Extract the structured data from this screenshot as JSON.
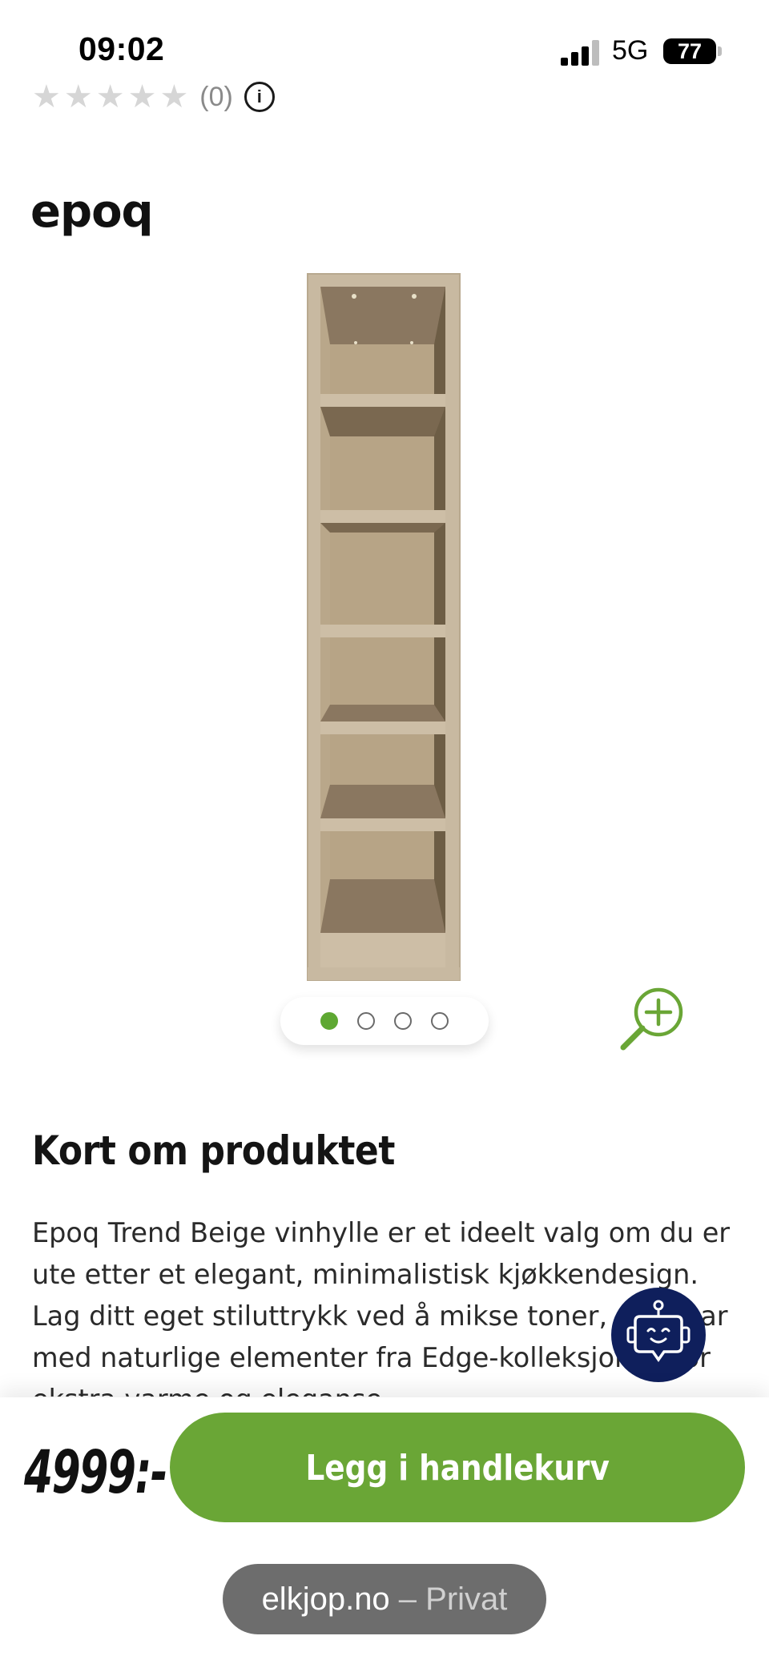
{
  "status_bar": {
    "time": "09:02",
    "network": "5G",
    "battery": "77"
  },
  "rating": {
    "stars": 5,
    "filled": 0,
    "count": "(0)",
    "info": "i"
  },
  "brand": {
    "logo_text": "epoq"
  },
  "product": {
    "image_alt": "Epoq Trend Beige vinhylle"
  },
  "carousel": {
    "total": 4,
    "active": 0
  },
  "section": {
    "title": "Kort om produktet",
    "description": "Epoq Trend Beige vinhylle er et ideelt valg om du er ute etter et elegant, minimalistisk kjøkkendesign. Lag ditt eget stiluttrykk ved å mikse toner, eller par med naturlige elementer fra Edge-kolleksjonen for ekstra varme og eleganse."
  },
  "purchase": {
    "price": "4999:-",
    "add_to_cart_label": "Legg i handlekurv"
  },
  "browser": {
    "domain": "elkjop.no",
    "separator": " – ",
    "mode": "Privat"
  },
  "colors": {
    "accent_green": "#6aa636",
    "chat_bg": "#0f1f5c"
  },
  "icons": [
    "signal-icon",
    "battery-icon",
    "info-icon",
    "zoom-in-icon",
    "chat-bot-icon"
  ]
}
